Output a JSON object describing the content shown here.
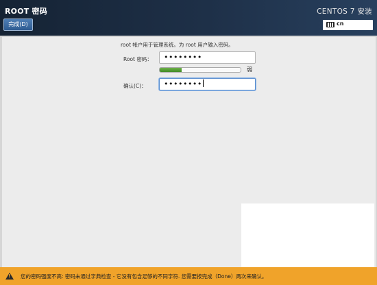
{
  "header": {
    "page_title": "ROOT 密码",
    "done_label": "完成(D)",
    "product_title": "CENTOS 7 安装",
    "keyboard_layout": "cn"
  },
  "form": {
    "description": "root 帐户用于管理系统。为 root 用户输入密码。",
    "root_password_label": "Root 密码：",
    "root_password_value": "••••••••",
    "confirm_label": "确认(C)：",
    "confirm_value": "••••••••",
    "strength_label": "弱",
    "strength_fraction": 0.27
  },
  "footer": {
    "warning_text": "您的密码强度不高: 密码未通过字典检查 - 它没有包含足够的不同字符. 您需要按完成（Done）两次来确认。"
  },
  "colors": {
    "header_bg": "#1e3048",
    "footer_bg": "#f0a32a",
    "strength_good": "#3f8a24"
  }
}
